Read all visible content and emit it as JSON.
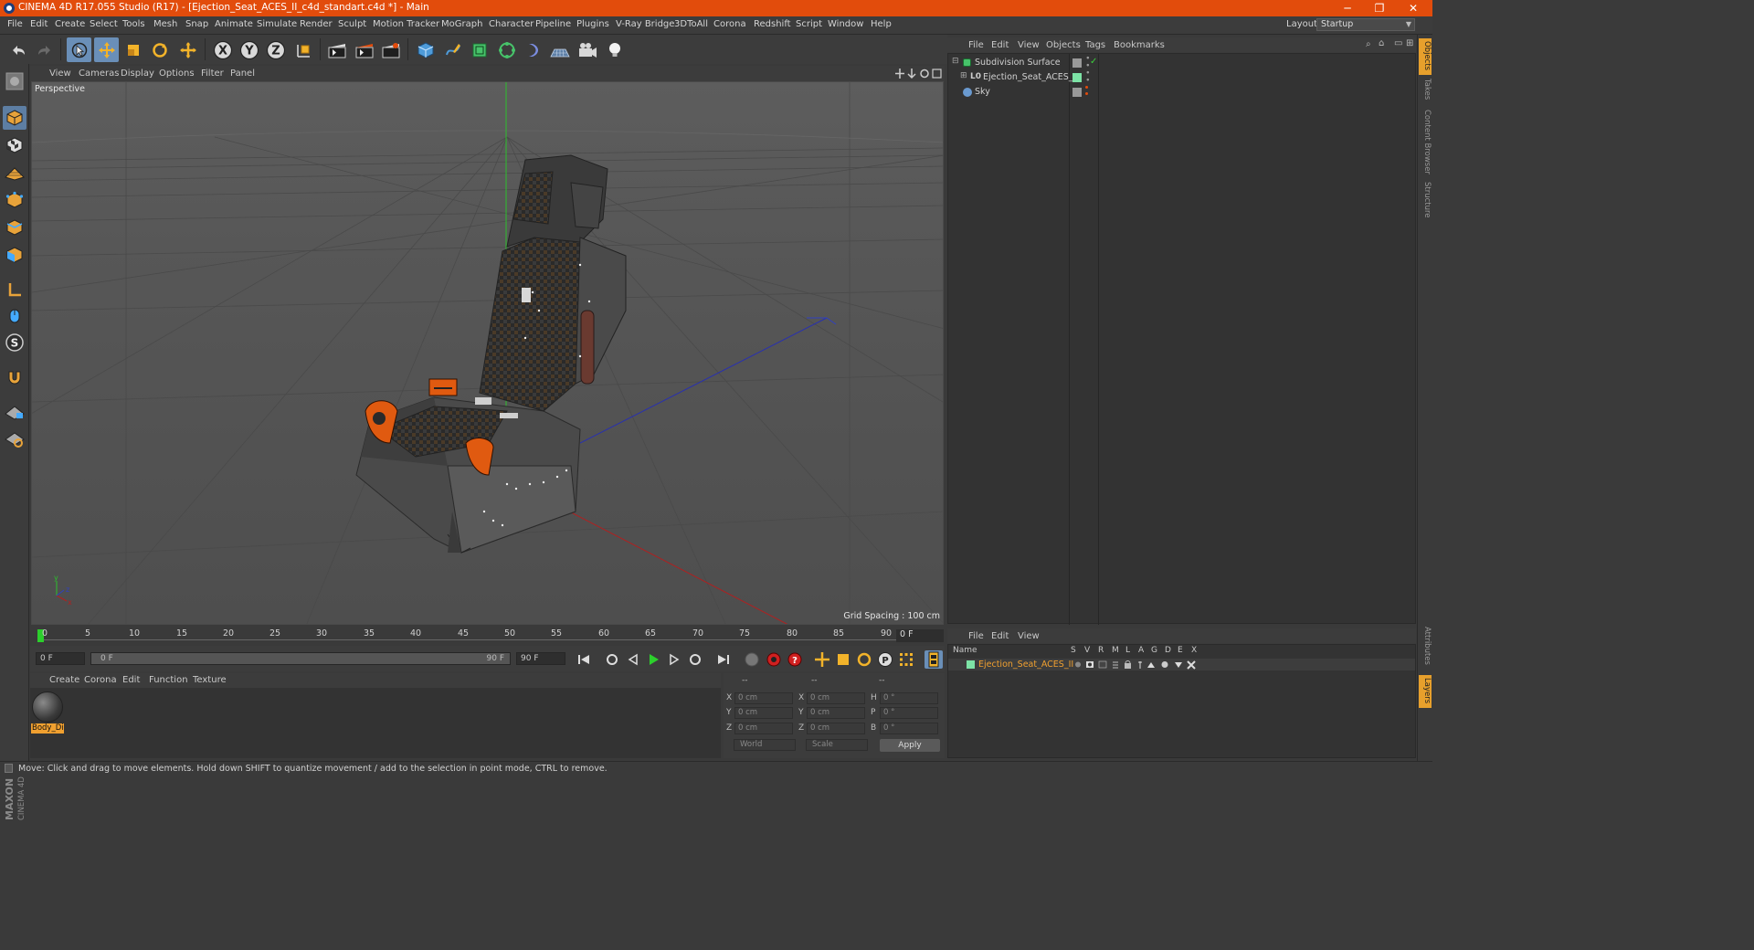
{
  "window": {
    "title": "CINEMA 4D R17.055 Studio (R17) - [Ejection_Seat_ACES_II_c4d_standart.c4d *] - Main",
    "minimize": "─",
    "restore": "❐",
    "close": "✕"
  },
  "menubar": {
    "items": [
      "File",
      "Edit",
      "Create",
      "Select",
      "Tools",
      "Mesh",
      "Snap",
      "Animate",
      "Simulate",
      "Render",
      "Sculpt",
      "Motion Tracker",
      "MoGraph",
      "Character",
      "Pipeline",
      "Plugins",
      "V-Ray Bridge",
      "3DToAll",
      "Corona",
      "Redshift",
      "Script",
      "Window",
      "Help"
    ],
    "layout_label": "Layout:",
    "layout_value": "Startup"
  },
  "viewport": {
    "menu": [
      "View",
      "Cameras",
      "Display",
      "Options",
      "Filter",
      "Panel"
    ],
    "camera_label": "Perspective",
    "grid_spacing": "Grid Spacing : 100 cm"
  },
  "timeline": {
    "ticks": [
      "0",
      "5",
      "10",
      "15",
      "20",
      "25",
      "30",
      "35",
      "40",
      "45",
      "50",
      "55",
      "60",
      "65",
      "70",
      "75",
      "80",
      "85",
      "90"
    ],
    "current_frame": "0 F"
  },
  "transport": {
    "start_field": "0 F",
    "range_start": "0 F",
    "range_end": "90 F",
    "end_field": "90 F"
  },
  "material_manager": {
    "menu": [
      "Create",
      "Corona",
      "Edit",
      "Function",
      "Texture"
    ],
    "materials": [
      {
        "name": "Body_Di"
      }
    ]
  },
  "coordinates": {
    "header": [
      "--",
      "--",
      "--"
    ],
    "rows": [
      {
        "a": "X",
        "v1": "0 cm",
        "b": "X",
        "v2": "0 cm",
        "c": "H",
        "v3": "0 °"
      },
      {
        "a": "Y",
        "v1": "0 cm",
        "b": "Y",
        "v2": "0 cm",
        "c": "P",
        "v3": "0 °"
      },
      {
        "a": "Z",
        "v1": "0 cm",
        "b": "Z",
        "v2": "0 cm",
        "c": "B",
        "v3": "0 °"
      }
    ],
    "mode_world": "World",
    "mode_scale": "Scale",
    "apply": "Apply"
  },
  "object_manager": {
    "menu": [
      "File",
      "Edit",
      "View",
      "Objects",
      "Tags",
      "Bookmarks"
    ],
    "objects": [
      {
        "name": "Subdivision Surface"
      },
      {
        "name": "Ejection_Seat_ACES_II"
      },
      {
        "name": "Sky"
      }
    ]
  },
  "layer_manager": {
    "menu": [
      "File",
      "Edit",
      "View"
    ],
    "col_name": "Name",
    "col_flags": [
      "S",
      "V",
      "R",
      "M",
      "L",
      "A",
      "G",
      "D",
      "E",
      "X"
    ],
    "layers": [
      {
        "name": "Ejection_Seat_ACES_II"
      }
    ]
  },
  "right_tabs": [
    "Objects",
    "Takes",
    "Content Browser",
    "Structure",
    "Attributes",
    "Layers"
  ],
  "status": "Move: Click and drag to move elements. Hold down SHIFT to quantize movement / add to the selection in point mode, CTRL to remove.",
  "logo": {
    "line1": "MAXON",
    "line2": "CINEMA 4D"
  },
  "colors": {
    "titlebar": "#e24c0c",
    "accent_blue": "#6a8fb8",
    "material_label": "#f0a030",
    "viewport_bg": "#585858"
  }
}
